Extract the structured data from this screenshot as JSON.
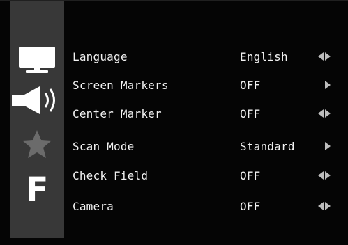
{
  "sidebar": {
    "icons": [
      {
        "name": "monitor-icon"
      },
      {
        "name": "speaker-icon"
      },
      {
        "name": "star-icon"
      },
      {
        "name": "f-function-icon",
        "text": "F"
      }
    ]
  },
  "menu": {
    "rows": [
      {
        "label": "Language",
        "value": "English",
        "arrows": "both"
      },
      {
        "label": "Screen Markers",
        "value": "OFF",
        "arrows": "right"
      },
      {
        "label": "Center Marker",
        "value": "OFF",
        "arrows": "both"
      },
      {
        "label": "Scan Mode",
        "value": "Standard",
        "arrows": "right"
      },
      {
        "label": "Check Field",
        "value": "OFF",
        "arrows": "both"
      },
      {
        "label": "Camera",
        "value": "OFF",
        "arrows": "both"
      }
    ]
  },
  "colors": {
    "background": "#050505",
    "sidebar": "#383838",
    "text": "#f2f2f2",
    "arrow": "#bdbdbd"
  }
}
